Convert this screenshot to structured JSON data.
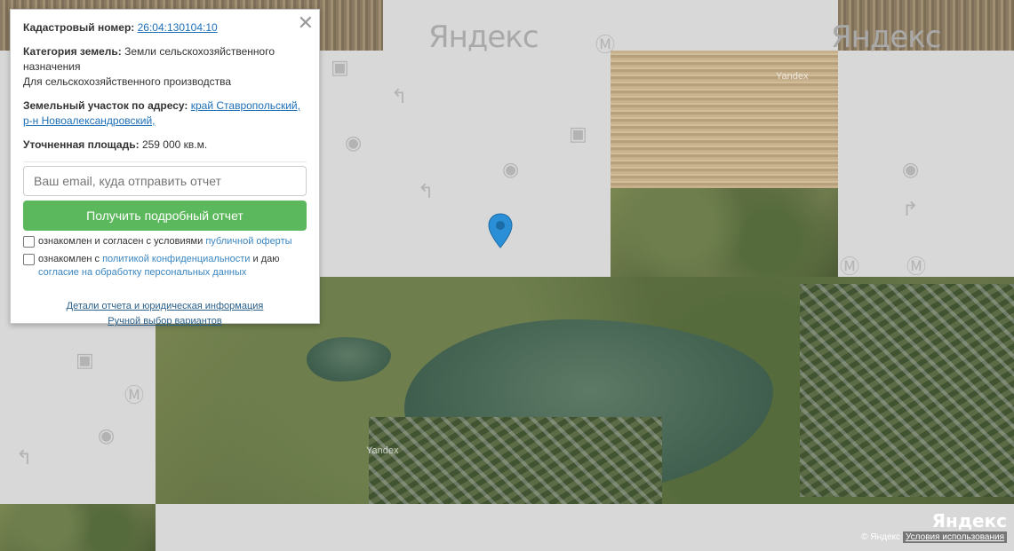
{
  "popup": {
    "cadastral_label": "Кадастровый номер:",
    "cadastral_value": "26:04:130104:10",
    "category_label": "Категория земель:",
    "category_value": "Земли сельскохозяйственного назначения",
    "category_use": "Для сельскохозяйственного производства",
    "address_label": "Земельный участок по адресу:",
    "address_value": "край Ставропольский, р-н Новоалександровский,",
    "area_label": "Уточненная площадь:",
    "area_value": "259 000 кв.м.",
    "email_placeholder": "Ваш email, куда отправить отчет",
    "submit_label": "Получить подробный отчет",
    "consent1_text": "ознакомлен и согласен с условиями",
    "consent1_link": "публичной оферты",
    "consent2_text": "ознакомлен с",
    "consent2_link": "политикой конфиденциальности",
    "consent2_mid": "и даю",
    "consent2_link2": "согласие на обработку персональных данных",
    "details_link": "Детали отчета и юридическая информация",
    "manual_link": "Ручной выбор вариантов"
  },
  "map": {
    "watermark": "Яндекс",
    "logo": "Яндекс",
    "copyright": "© Яндекс",
    "terms": "Условия использования",
    "imagery_mark": "Yandex"
  }
}
